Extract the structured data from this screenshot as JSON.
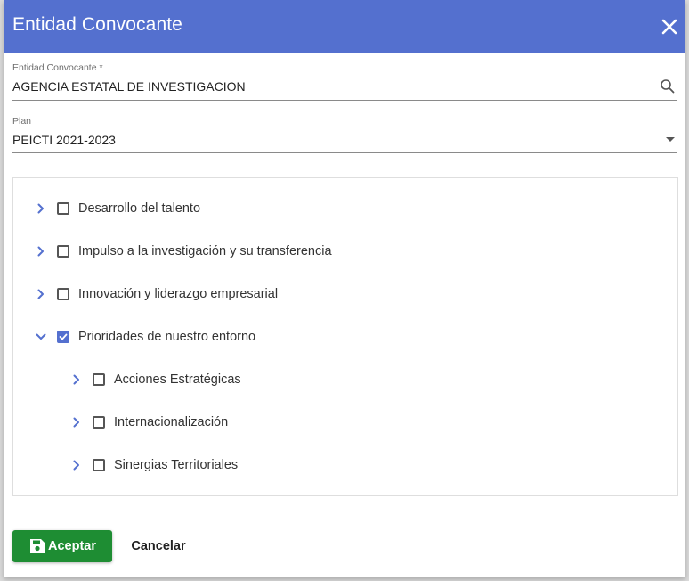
{
  "dialog": {
    "title": "Entidad Convocante",
    "entidad": {
      "label": "Entidad Convocante *",
      "value": "AGENCIA ESTATAL DE INVESTIGACION"
    },
    "plan": {
      "label": "Plan",
      "value": "PEICTI 2021-2023"
    },
    "tree": {
      "items": [
        {
          "label": "Desarrollo del talento",
          "expanded": false,
          "checked": false,
          "level": 0
        },
        {
          "label": "Impulso a la investigación y su transferencia",
          "expanded": false,
          "checked": false,
          "level": 0
        },
        {
          "label": "Innovación y liderazgo empresarial",
          "expanded": false,
          "checked": false,
          "level": 0
        },
        {
          "label": "Prioridades de nuestro entorno",
          "expanded": true,
          "checked": true,
          "level": 0
        },
        {
          "label": "Acciones Estratégicas",
          "expanded": false,
          "checked": false,
          "level": 1
        },
        {
          "label": "Internacionalización",
          "expanded": false,
          "checked": false,
          "level": 1
        },
        {
          "label": "Sinergias Territoriales",
          "expanded": false,
          "checked": false,
          "level": 1
        }
      ]
    },
    "buttons": {
      "accept": "Aceptar",
      "cancel": "Cancelar"
    }
  },
  "colors": {
    "header": "#5470cf",
    "accent": "#5470cf",
    "accept_button": "#1e8d33"
  },
  "icons": {
    "close": "close-icon",
    "search": "search-icon",
    "dropdown": "dropdown-arrow-icon",
    "collapsed": "chevron-right-icon",
    "expanded": "chevron-down-icon",
    "save": "save-icon"
  }
}
